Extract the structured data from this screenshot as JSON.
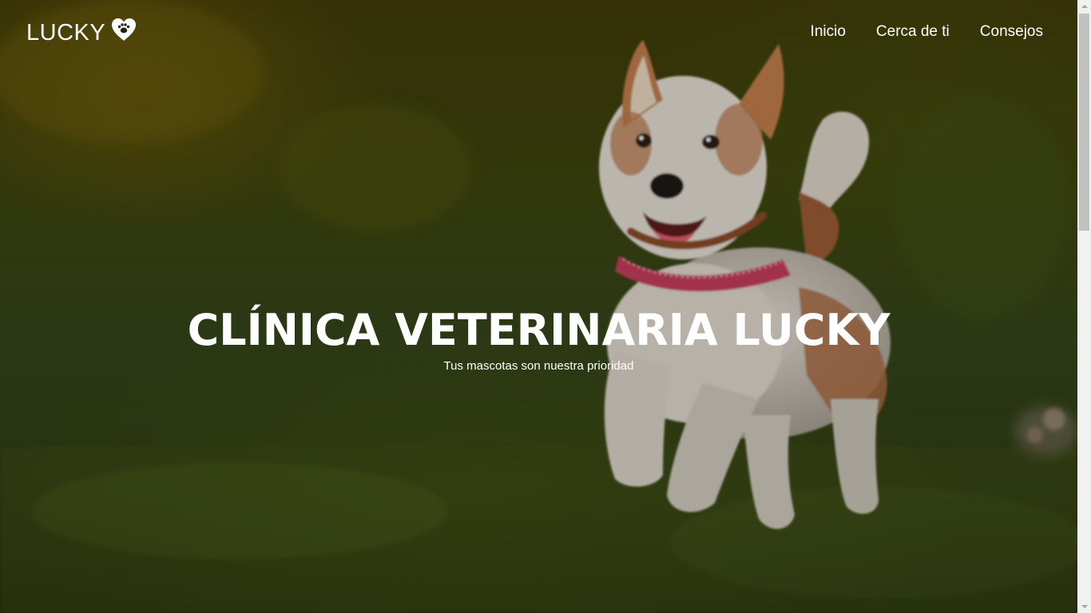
{
  "navbar": {
    "brand": "LUCKY",
    "brand_icon": "heart-paw-icon",
    "links": [
      "Inicio",
      "Cerca de ti",
      "Consejos"
    ]
  },
  "hero": {
    "title": "CLÍNICA VETERINARIA LUCKY",
    "subtitle": "Tus mascotas son nuestra prioridad",
    "background_image": "dog-running-on-grass"
  },
  "scrollbar": {
    "position_fraction": 0
  },
  "colors": {
    "text": "#ffffff",
    "overlay": "#1f2410",
    "grass": "#33431a"
  }
}
